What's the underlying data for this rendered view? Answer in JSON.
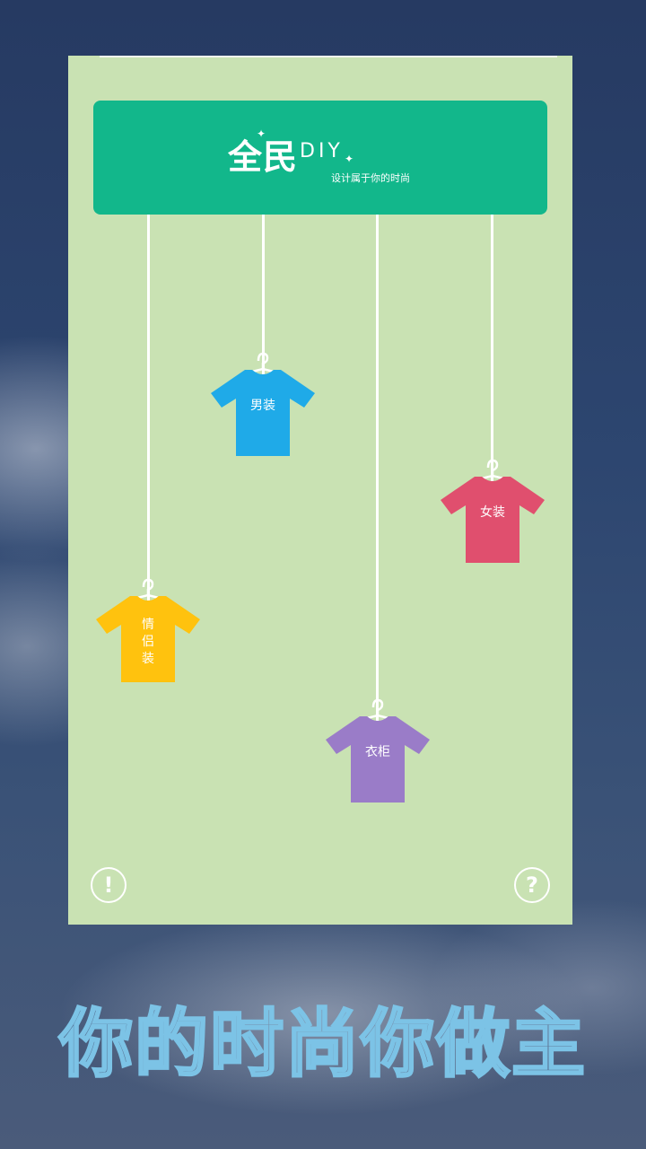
{
  "logo": {
    "main": "全民",
    "diy": "DIY",
    "slogan": "设计属于你的时尚"
  },
  "categories": [
    {
      "label": "男装",
      "color": "#1faae8"
    },
    {
      "label": "女装",
      "color": "#e04f6e"
    },
    {
      "label": "情侣装",
      "color": "#ffc20e"
    },
    {
      "label": "衣柜",
      "color": "#9a7cc8"
    }
  ],
  "buttons": {
    "info_icon": "!",
    "help_icon": "?"
  },
  "tagline": "你的时尚你做主"
}
